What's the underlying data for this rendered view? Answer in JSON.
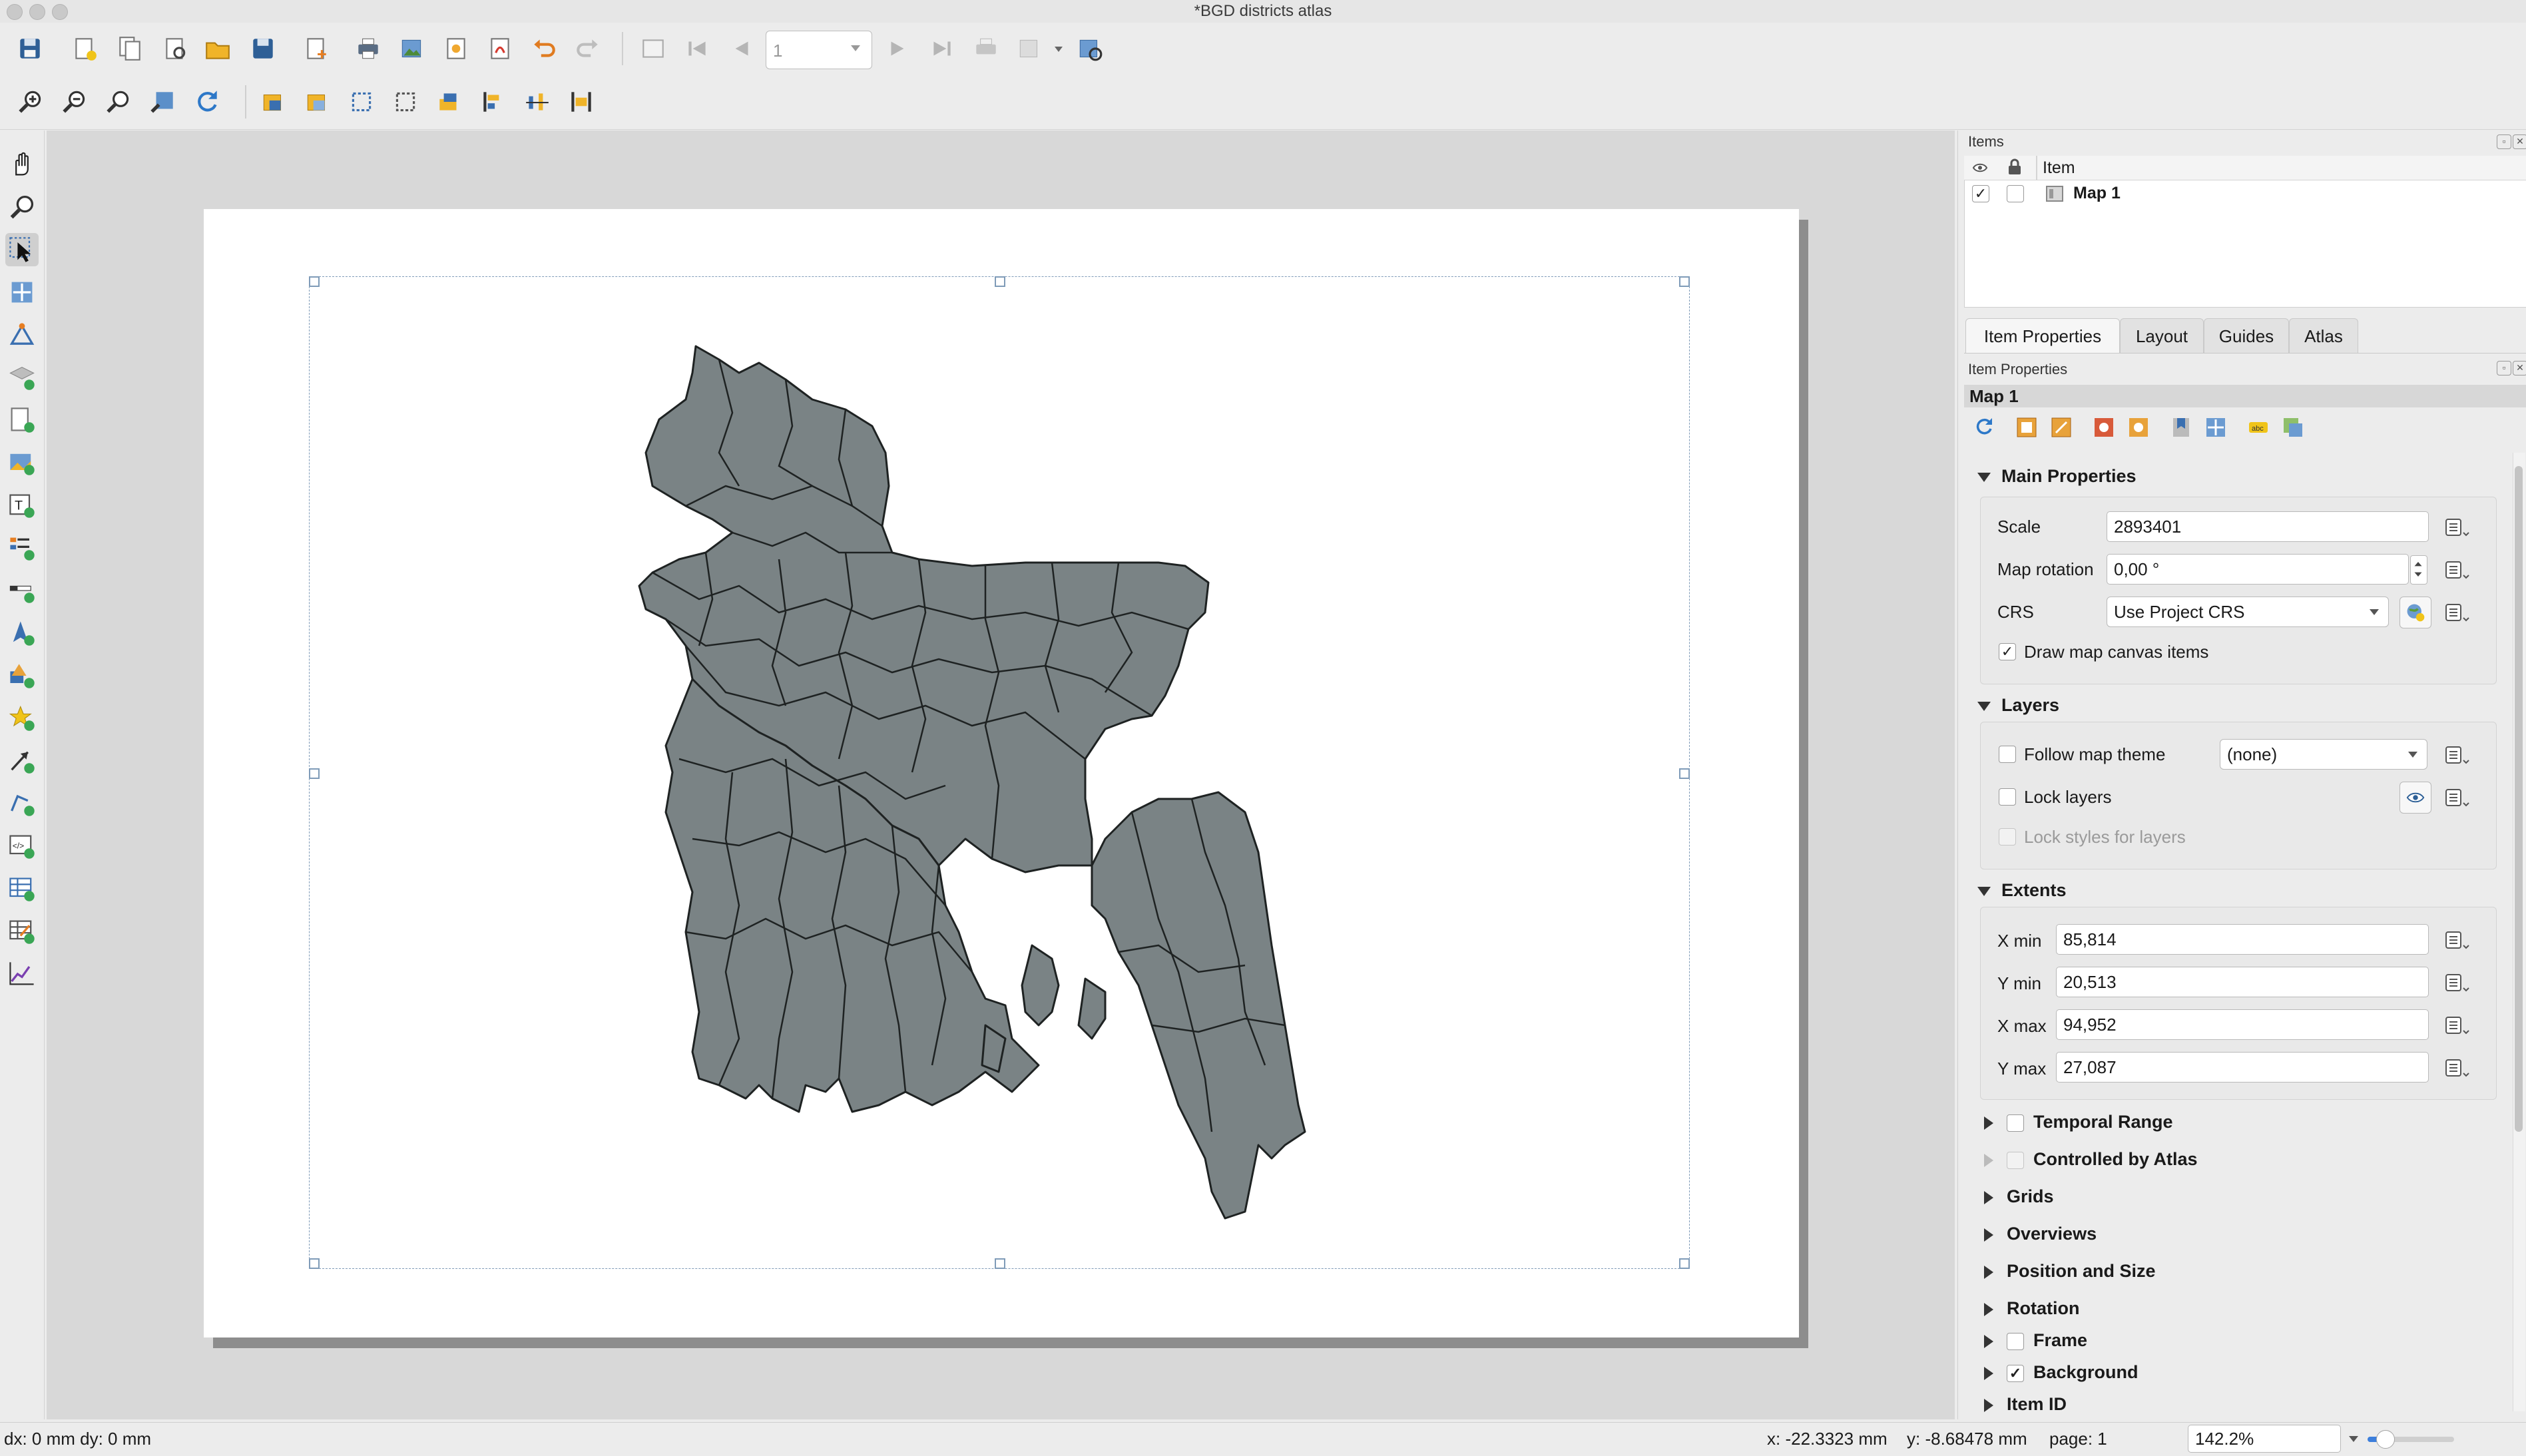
{
  "window": {
    "title": "*BGD districts atlas"
  },
  "toolbar": {
    "page_number": "1"
  },
  "items_panel": {
    "title": "Items",
    "column_item": "Item",
    "rows": [
      {
        "name": "Map 1",
        "visible_check": "✓"
      }
    ]
  },
  "tabs": [
    {
      "label": "Item Properties",
      "active": true
    },
    {
      "label": "Layout",
      "active": false
    },
    {
      "label": "Guides",
      "active": false
    },
    {
      "label": "Atlas",
      "active": false
    }
  ],
  "item_properties": {
    "panel_title": "Item Properties",
    "item_name": "Map 1",
    "main": {
      "header": "Main Properties",
      "scale_label": "Scale",
      "scale_value": "2893401",
      "rotation_label": "Map rotation",
      "rotation_value": "0,00 °",
      "crs_label": "CRS",
      "crs_value": "Use Project CRS",
      "draw_items_label": "Draw map canvas items",
      "draw_items_check": "✓"
    },
    "layers": {
      "header": "Layers",
      "follow_theme_label": "Follow map theme",
      "follow_theme_value": "(none)",
      "lock_layers_label": "Lock layers",
      "lock_styles_label": "Lock styles for layers"
    },
    "extents": {
      "header": "Extents",
      "xmin_label": "X min",
      "xmin_value": "85,814",
      "ymin_label": "Y min",
      "ymin_value": "20,513",
      "xmax_label": "X max",
      "xmax_value": "94,952",
      "ymax_label": "Y max",
      "ymax_value": "27,087"
    },
    "collapsed": {
      "temporal": "Temporal Range",
      "atlas": "Controlled by Atlas",
      "grids": "Grids",
      "overviews": "Overviews",
      "position": "Position and Size",
      "rotation": "Rotation",
      "frame": "Frame",
      "background": "Background",
      "background_check": "✓",
      "item_id": "Item ID"
    }
  },
  "statusbar": {
    "delta": "dx: 0 mm dy: 0 mm",
    "x": "x: -22.3323 mm",
    "y": "y: -8.68478 mm",
    "page": "page: 1",
    "zoom": "142.2%",
    "zoom_slider": 0.2
  },
  "colors": {
    "map_fill": "#7a8385",
    "map_stroke": "#1e2222",
    "accent": "#3d7fdc"
  }
}
